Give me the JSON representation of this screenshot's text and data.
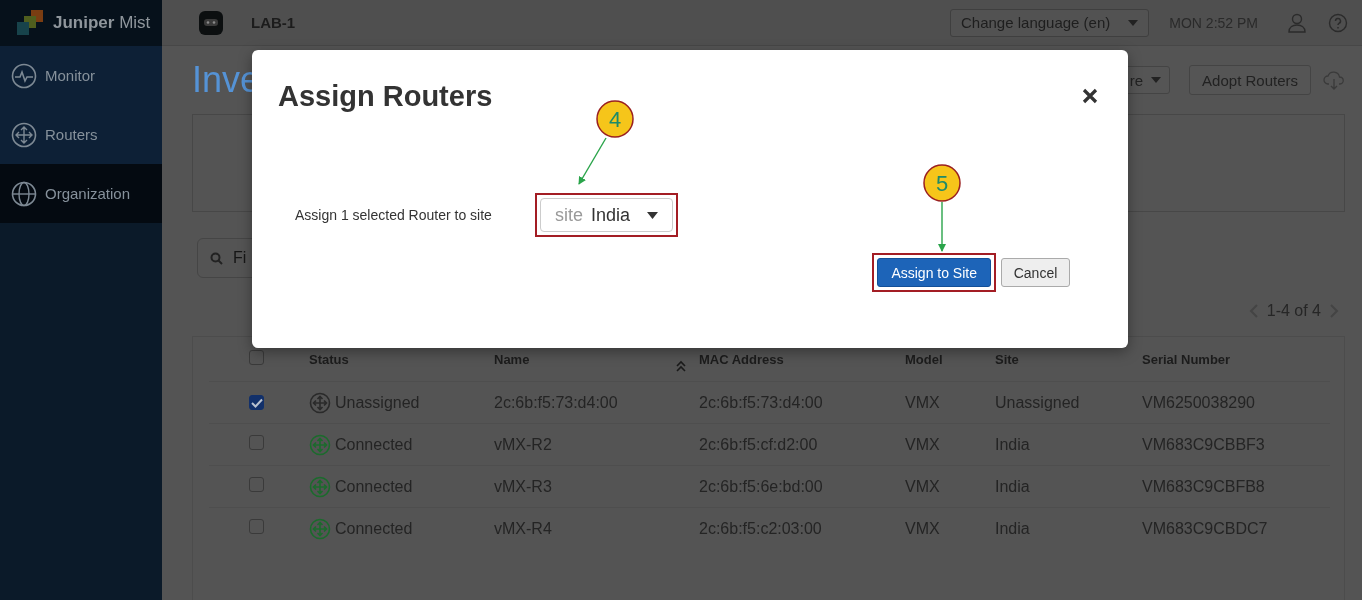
{
  "sidebar": {
    "logo": "**Juniper** Mist",
    "items": [
      {
        "label": "Monitor",
        "kind": "monitor",
        "selected": false
      },
      {
        "label": "Routers",
        "kind": "routers",
        "selected": false
      },
      {
        "label": "Organization",
        "kind": "organization",
        "selected": true
      }
    ]
  },
  "topbar": {
    "site": "LAB-1",
    "language": "Change language (en)",
    "time": "MON 2:52 PM"
  },
  "page": {
    "title": "Inve",
    "search_placeholder": "Fi",
    "more_button": "re",
    "adopt_button": "Adopt Routers",
    "pagination": "1-4 of 4"
  },
  "table": {
    "select_all_checked": false,
    "columns": [
      "Status",
      "Name",
      "MAC Address",
      "Model",
      "Site",
      "Serial Number"
    ],
    "rows": [
      {
        "checked": true,
        "status": "Unassigned",
        "color": "#2a2a2a",
        "name": "2c:6b:f5:73:d4:00",
        "mac": "2c:6b:f5:73:d4:00",
        "model": "VMX",
        "site": "Unassigned",
        "serial": "VM6250038290"
      },
      {
        "checked": false,
        "status": "Connected",
        "color": "#1b6b2c",
        "name": "vMX-R2",
        "mac": "2c:6b:f5:cf:d2:00",
        "model": "VMX",
        "site": "India",
        "serial": "VM683C9CBBF3"
      },
      {
        "checked": false,
        "status": "Connected",
        "color": "#1b6b2c",
        "name": "vMX-R3",
        "mac": "2c:6b:f5:6e:bd:00",
        "model": "VMX",
        "site": "India",
        "serial": "VM683C9CBFB8"
      },
      {
        "checked": false,
        "status": "Connected",
        "color": "#1b6b2c",
        "name": "vMX-R4",
        "mac": "2c:6b:f5:c2:03:00",
        "model": "VMX",
        "site": "India",
        "serial": "VM683C9CBDC7"
      }
    ]
  },
  "modal": {
    "title": "Assign Routers",
    "label": "Assign 1 selected Router to site",
    "select_prefix": "site",
    "select_value": "India",
    "primary_button": "Assign to Site",
    "cancel_button": "Cancel"
  },
  "annotations": [
    {
      "label": "4"
    },
    {
      "label": "5"
    }
  ]
}
